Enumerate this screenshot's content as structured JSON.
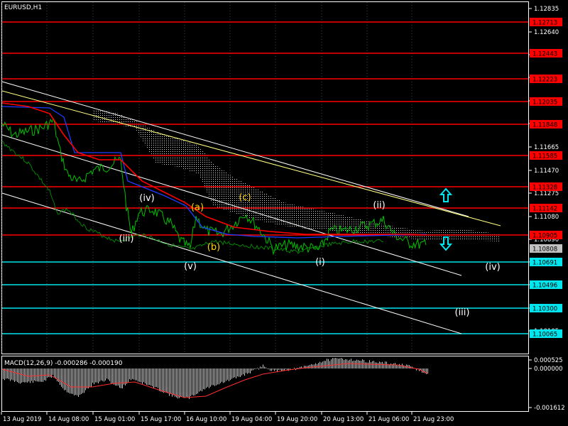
{
  "window": {
    "title": "EURUSD,H1"
  },
  "price_axis": {
    "ticks": [
      "1.12835",
      "1.12640",
      "1.12450",
      "1.12260",
      "1.12045",
      "1.11855",
      "1.11665",
      "1.11470",
      "1.11275",
      "1.11080",
      "1.10890",
      "1.10700",
      "1.10500",
      "1.10310",
      "1.10105"
    ]
  },
  "horizontal_levels": [
    {
      "label": "1.12713",
      "color": "#ff0000"
    },
    {
      "label": "1.12443",
      "color": "#ff0000"
    },
    {
      "label": "1.12223",
      "color": "#ff0000"
    },
    {
      "label": "1.12035",
      "color": "#ff0000"
    },
    {
      "label": "1.11848",
      "color": "#ff0000"
    },
    {
      "label": "1.11585",
      "color": "#ff0000"
    },
    {
      "label": "1.11328",
      "color": "#ff0000"
    },
    {
      "label": "1.11142",
      "color": "#ff0000"
    },
    {
      "label": "1.10905",
      "color": "#ff0000"
    },
    {
      "label": "1.10691",
      "color": "#00e5ee"
    },
    {
      "label": "1.10496",
      "color": "#00e5ee"
    },
    {
      "label": "1.10300",
      "color": "#00e5ee"
    },
    {
      "label": "1.10065",
      "color": "#00e5ee"
    }
  ],
  "current_price": {
    "label": "1.10808",
    "color": "#c0c0c0"
  },
  "wave_labels": [
    {
      "text": "(iv)",
      "color": "#ffffff"
    },
    {
      "text": "(iii)",
      "color": "#ffffff"
    },
    {
      "text": "(v)",
      "color": "#ffffff"
    },
    {
      "text": "(a)",
      "color": "#ffd700"
    },
    {
      "text": "(b)",
      "color": "#ffd700"
    },
    {
      "text": "(c)",
      "color": "#ffd700"
    },
    {
      "text": "(i)",
      "color": "#ffffff"
    },
    {
      "text": "(ii)",
      "color": "#ffffff"
    },
    {
      "text": "(iv)",
      "color": "#ffffff"
    },
    {
      "text": "(iii)",
      "color": "#ffffff"
    }
  ],
  "arrows": {
    "up": {
      "icon": "hollow-up-arrow-icon",
      "color": "#00e5ee"
    },
    "down": {
      "icon": "hollow-down-arrow-icon",
      "color": "#00e5ee"
    }
  },
  "macd": {
    "title": "MACD(12,26,9) -0.000286 -0.000190",
    "ticks": [
      "0.000525",
      "0.000000",
      "-0.001612"
    ]
  },
  "time_axis": {
    "ticks": [
      "13 Aug 2019",
      "14 Aug 08:00",
      "15 Aug 01:00",
      "15 Aug 17:00",
      "16 Aug 10:00",
      "19 Aug 04:00",
      "19 Aug 20:00",
      "20 Aug 13:00",
      "21 Aug 06:00",
      "21 Aug 23:00"
    ]
  },
  "colors": {
    "background": "#000000",
    "grid": "#2f4f4f",
    "axis_text": "#ffffff",
    "price_line": "#00c000",
    "ma_red": "#ff0000",
    "ma_blue": "#1e3cff",
    "channel": "#ffffff",
    "trendline": "#ffff80"
  }
}
